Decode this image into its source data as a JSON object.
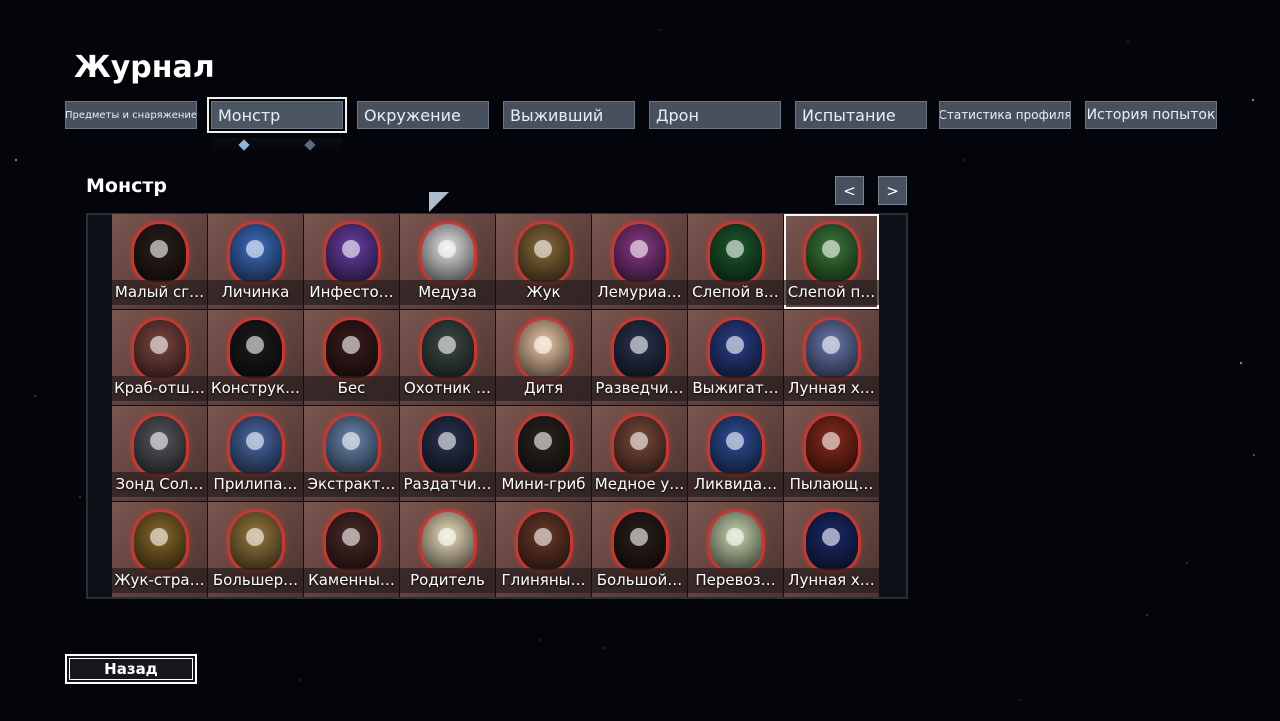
{
  "title": "Журнал",
  "tabs": [
    {
      "label": "Предметы и снаряжение"
    },
    {
      "label": "Монстр"
    },
    {
      "label": "Окружение"
    },
    {
      "label": "Выживший"
    },
    {
      "label": "Дрон"
    },
    {
      "label": "Испытание"
    },
    {
      "label": "Статистика профиля"
    },
    {
      "label": "История попыток"
    }
  ],
  "section_title": "Монстр",
  "prev_label": "<",
  "next_label": ">",
  "back_label": "Назад",
  "monsters": [
    {
      "label": "Малый сг…",
      "color": "#2a1f1a",
      "icon": "egg-creature-icon"
    },
    {
      "label": "Личинка",
      "color": "#3d6fc4",
      "icon": "larva-icon"
    },
    {
      "label": "Инфесто…",
      "color": "#6a3fa8",
      "icon": "eye-creature-icon"
    },
    {
      "label": "Медуза",
      "color": "#e6e6ea",
      "icon": "jellyfish-icon"
    },
    {
      "label": "Жук",
      "color": "#8a6a3a",
      "icon": "beetle-icon"
    },
    {
      "label": "Лемуриа…",
      "color": "#8b3a8a",
      "icon": "lemurian-icon"
    },
    {
      "label": "Слепой в…",
      "color": "#1d5a2e",
      "icon": "blind-vermin-icon"
    },
    {
      "label": "Слепой п…",
      "color": "#3b7a3a",
      "icon": "blind-pest-icon"
    },
    {
      "label": "Краб-отш…",
      "color": "#7d4640",
      "icon": "hermit-crab-icon"
    },
    {
      "label": "Конструк…",
      "color": "#1b1b1f",
      "icon": "construct-icon"
    },
    {
      "label": "Бес",
      "color": "#3a1c1c",
      "icon": "imp-icon"
    },
    {
      "label": "Охотник …",
      "color": "#3d4a48",
      "icon": "hunter-icon"
    },
    {
      "label": "Дитя",
      "color": "#f0c9a8",
      "icon": "child-icon"
    },
    {
      "label": "Разведчи…",
      "color": "#2a3350",
      "icon": "scout-icon"
    },
    {
      "label": "Выжигат…",
      "color": "#2a3f8a",
      "icon": "scorcher-icon"
    },
    {
      "label": "Лунная х…",
      "color": "#6a7ab0",
      "icon": "lunar-chimera-icon"
    },
    {
      "label": "Зонд Сол…",
      "color": "#55585e",
      "icon": "solus-probe-icon"
    },
    {
      "label": "Прилипа…",
      "color": "#4a6aa8",
      "icon": "leech-icon"
    },
    {
      "label": "Экстракт…",
      "color": "#6a88b0",
      "icon": "extractor-icon"
    },
    {
      "label": "Раздатчи…",
      "color": "#2a3350",
      "icon": "dispenser-icon"
    },
    {
      "label": "Мини-гриб",
      "color": "#2a2420",
      "icon": "mini-mushroom-icon"
    },
    {
      "label": "Медное у…",
      "color": "#7a4a3a",
      "icon": "copper-icon"
    },
    {
      "label": "Ликвида…",
      "color": "#2f4f9a",
      "icon": "liquidator-icon"
    },
    {
      "label": "Пылающ…",
      "color": "#8a2a1a",
      "icon": "blazing-icon"
    },
    {
      "label": "Жук-стра…",
      "color": "#8a6a2a",
      "icon": "beetle-guard-icon"
    },
    {
      "label": "Большер…",
      "color": "#9a7a40",
      "icon": "bighorn-icon"
    },
    {
      "label": "Каменны…",
      "color": "#4a2a28",
      "icon": "stone-icon"
    },
    {
      "label": "Родитель",
      "color": "#eee0c0",
      "icon": "parent-icon"
    },
    {
      "label": "Глиняны…",
      "color": "#6a3a28",
      "icon": "clay-icon"
    },
    {
      "label": "Большой…",
      "color": "#2a1f1a",
      "icon": "big-egg-icon"
    },
    {
      "label": "Перевоз…",
      "color": "#c8d8b0",
      "icon": "transporter-icon"
    },
    {
      "label": "Лунная х…",
      "color": "#1a2a6a",
      "icon": "lunar-exploder-icon"
    }
  ],
  "colors": {
    "accent": "#c23a33",
    "tab_bg": "#47505c",
    "pip_active": "#8fb4d8",
    "pip_inactive": "#5a6b80"
  }
}
